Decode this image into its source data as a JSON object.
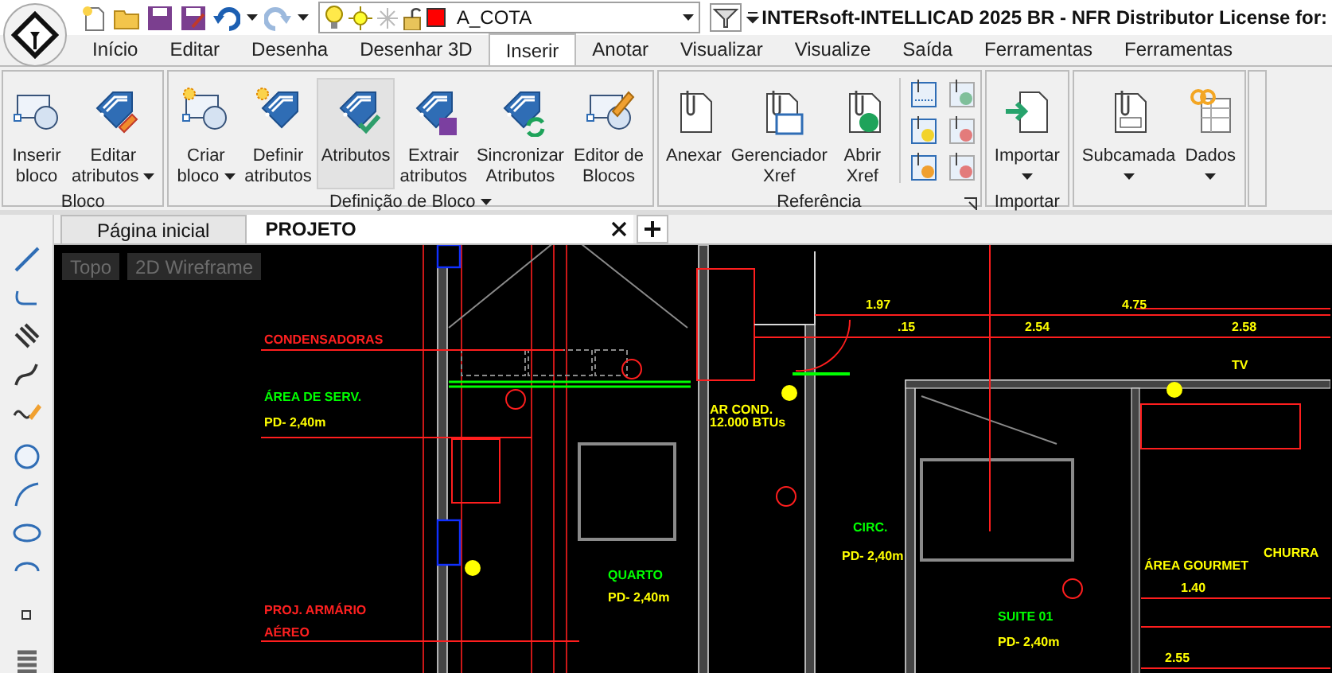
{
  "window": {
    "title": "INTERsoft-INTELLICAD 2025 BR - NFR Distributor License for:"
  },
  "layer": {
    "name": "A_COTA",
    "color": "#ff0000"
  },
  "menu_tabs": [
    {
      "label": "Início",
      "selected": false
    },
    {
      "label": "Editar",
      "selected": false
    },
    {
      "label": "Desenha",
      "selected": false
    },
    {
      "label": "Desenhar 3D",
      "selected": false
    },
    {
      "label": "Inserir",
      "selected": true
    },
    {
      "label": "Anotar",
      "selected": false
    },
    {
      "label": "Visualizar",
      "selected": false
    },
    {
      "label": "Visualize",
      "selected": false
    },
    {
      "label": "Saída",
      "selected": false
    },
    {
      "label": "Ferramentas",
      "selected": false
    },
    {
      "label": "Ferramentas",
      "selected": false
    }
  ],
  "ribbon_groups": [
    {
      "title": "Bloco",
      "title_dropdown": false,
      "launcher": false,
      "buttons": [
        {
          "lines": [
            "Inserir",
            "bloco"
          ],
          "dropdown": false,
          "selected": false
        },
        {
          "lines": [
            "Editar",
            "atributos"
          ],
          "dropdown": true,
          "selected": false
        }
      ]
    },
    {
      "title": "Definição de Bloco",
      "title_dropdown": true,
      "launcher": false,
      "buttons": [
        {
          "lines": [
            "Criar",
            "bloco"
          ],
          "dropdown": true,
          "selected": false
        },
        {
          "lines": [
            "Definir",
            "atributos"
          ],
          "dropdown": false,
          "selected": false
        },
        {
          "lines": [
            "Atributos"
          ],
          "dropdown": false,
          "selected": true
        },
        {
          "lines": [
            "Extrair",
            "atributos"
          ],
          "dropdown": false,
          "selected": false
        },
        {
          "lines": [
            "Sincronizar",
            "Atributos"
          ],
          "dropdown": false,
          "selected": false
        },
        {
          "lines": [
            "Editor de",
            "Blocos"
          ],
          "dropdown": false,
          "selected": false
        }
      ]
    },
    {
      "title": "Referência",
      "title_dropdown": false,
      "launcher": true,
      "buttons": [
        {
          "lines": [
            "Anexar"
          ],
          "dropdown": false,
          "selected": false
        },
        {
          "lines": [
            "Gerenciador",
            "Xref"
          ],
          "dropdown": false,
          "selected": false
        },
        {
          "lines": [
            "Abrir",
            "Xref"
          ],
          "dropdown": false,
          "selected": false
        }
      ]
    },
    {
      "title": "Importar",
      "title_dropdown": false,
      "launcher": false,
      "buttons": [
        {
          "lines": [
            "Importar"
          ],
          "dropdown": true,
          "selected": false
        }
      ]
    },
    {
      "buttons": [
        {
          "lines": [
            "Subcamada"
          ],
          "dropdown": true,
          "selected": false
        },
        {
          "lines": [
            "Dados"
          ],
          "dropdown": true,
          "selected": false
        }
      ]
    }
  ],
  "doc_tabs": [
    {
      "label": "Página inicial",
      "selected": false
    },
    {
      "label": "PROJETO",
      "selected": true
    }
  ],
  "viewport_controls": [
    "Topo",
    "2D Wireframe"
  ],
  "drawing_labels": [
    {
      "text": "1.97",
      "kind": "info"
    },
    {
      "text": "4.75",
      "kind": "info"
    },
    {
      "text": ".15",
      "kind": "info"
    },
    {
      "text": "2.54",
      "kind": "info"
    },
    {
      "text": "2.58",
      "kind": "info"
    },
    {
      "text": "CONDENSADORAS",
      "kind": "note"
    },
    {
      "text": "TV",
      "kind": "info"
    },
    {
      "text": "ÁREA DE SERV.",
      "kind": "room"
    },
    {
      "text": "AR COND.",
      "kind": "info"
    },
    {
      "text": "PD- 2,40m",
      "kind": "info"
    },
    {
      "text": "12.000 BTUs",
      "kind": "info"
    },
    {
      "text": "CIRC.",
      "kind": "room"
    },
    {
      "text": "PD- 2,40m",
      "kind": "info"
    },
    {
      "text": "CHURRA",
      "kind": "info"
    },
    {
      "text": "ÁREA GOURMET",
      "kind": "info"
    },
    {
      "text": "QUARTO",
      "kind": "room"
    },
    {
      "text": "PD- 2,40m",
      "kind": "info"
    },
    {
      "text": "1.40",
      "kind": "info"
    },
    {
      "text": "PROJ. ARMÁRIO",
      "kind": "note"
    },
    {
      "text": "SUITE 01",
      "kind": "room"
    },
    {
      "text": "AÉREO",
      "kind": "note"
    },
    {
      "text": "PD- 2,40m",
      "kind": "info"
    },
    {
      "text": "2.55",
      "kind": "info"
    }
  ]
}
